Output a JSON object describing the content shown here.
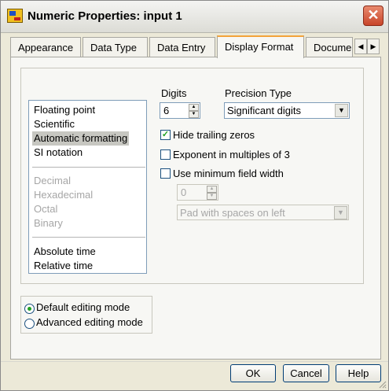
{
  "window": {
    "title": "Numeric Properties: input 1"
  },
  "tabs": [
    {
      "label": "Appearance"
    },
    {
      "label": "Data Type"
    },
    {
      "label": "Data Entry"
    },
    {
      "label": "Display Format",
      "active": true
    },
    {
      "label": "Documentation"
    }
  ],
  "format_list": {
    "group1": [
      "Floating point",
      "Scientific",
      "Automatic formatting",
      "SI notation"
    ],
    "selected": "Automatic formatting",
    "group2": [
      "Decimal",
      "Hexadecimal",
      "Octal",
      "Binary"
    ],
    "group3": [
      "Absolute time",
      "Relative time"
    ]
  },
  "digits": {
    "label": "Digits",
    "value": "6"
  },
  "precision_type": {
    "label": "Precision Type",
    "value": "Significant digits"
  },
  "options": {
    "hide_trailing_zeros": {
      "label": "Hide trailing zeros",
      "checked": true
    },
    "exponent_multiples_3": {
      "label": "Exponent in multiples of 3",
      "checked": false
    },
    "use_min_field_width": {
      "label": "Use minimum field width",
      "checked": false
    }
  },
  "min_width": {
    "value": "0"
  },
  "padding": {
    "value": "Pad with spaces on left"
  },
  "editing_mode": {
    "default": {
      "label": "Default editing mode",
      "selected": true
    },
    "advanced": {
      "label": "Advanced editing mode",
      "selected": false
    }
  },
  "buttons": {
    "ok": "OK",
    "cancel": "Cancel",
    "help": "Help"
  },
  "colors": {
    "accent_tab": "#f2a33a",
    "check_green": "#21a121",
    "close_red": "#c8452a"
  }
}
